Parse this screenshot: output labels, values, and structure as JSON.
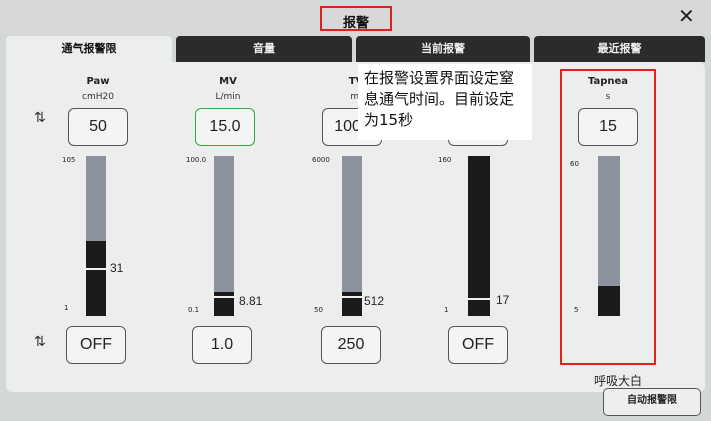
{
  "window": {
    "title": "报警",
    "close_glyph": "✕"
  },
  "tabs": [
    {
      "label": "通气报警限",
      "active": true
    },
    {
      "label": "音量",
      "active": false
    },
    {
      "label": "当前报警",
      "active": false
    },
    {
      "label": "最近报警",
      "active": false
    }
  ],
  "params": [
    {
      "name": "Paw",
      "unit": "cmH20",
      "upper": "50",
      "lower": "OFF",
      "scale_top": "105",
      "scale_bottom": "1",
      "value": "31",
      "fill_pct": 37
    },
    {
      "name": "MV",
      "unit": "L/min",
      "upper": "15.0",
      "lower": "1.0",
      "scale_top": "100.0",
      "scale_bottom": "0.1",
      "value": "8.81",
      "fill_pct": 10
    },
    {
      "name": "TV",
      "unit": "ml",
      "upper": "1000",
      "lower": "250",
      "scale_top": "6000",
      "scale_bottom": "50",
      "value": "512",
      "fill_pct": 10
    },
    {
      "name": "",
      "unit": "",
      "upper": "",
      "lower": "OFF",
      "scale_top": "160",
      "scale_bottom": "1",
      "value": "17",
      "fill_pct": 100
    },
    {
      "name": "Tapnea",
      "unit": "s",
      "upper": "15",
      "lower": "",
      "scale_top": "60",
      "scale_bottom": "5",
      "value": "",
      "fill_pct": 17
    }
  ],
  "annotation": {
    "text": "在报警设置界面设定窒息通气时间。目前设定为15秒"
  },
  "watermark": "呼吸大白",
  "auto_button": "自动报警限"
}
